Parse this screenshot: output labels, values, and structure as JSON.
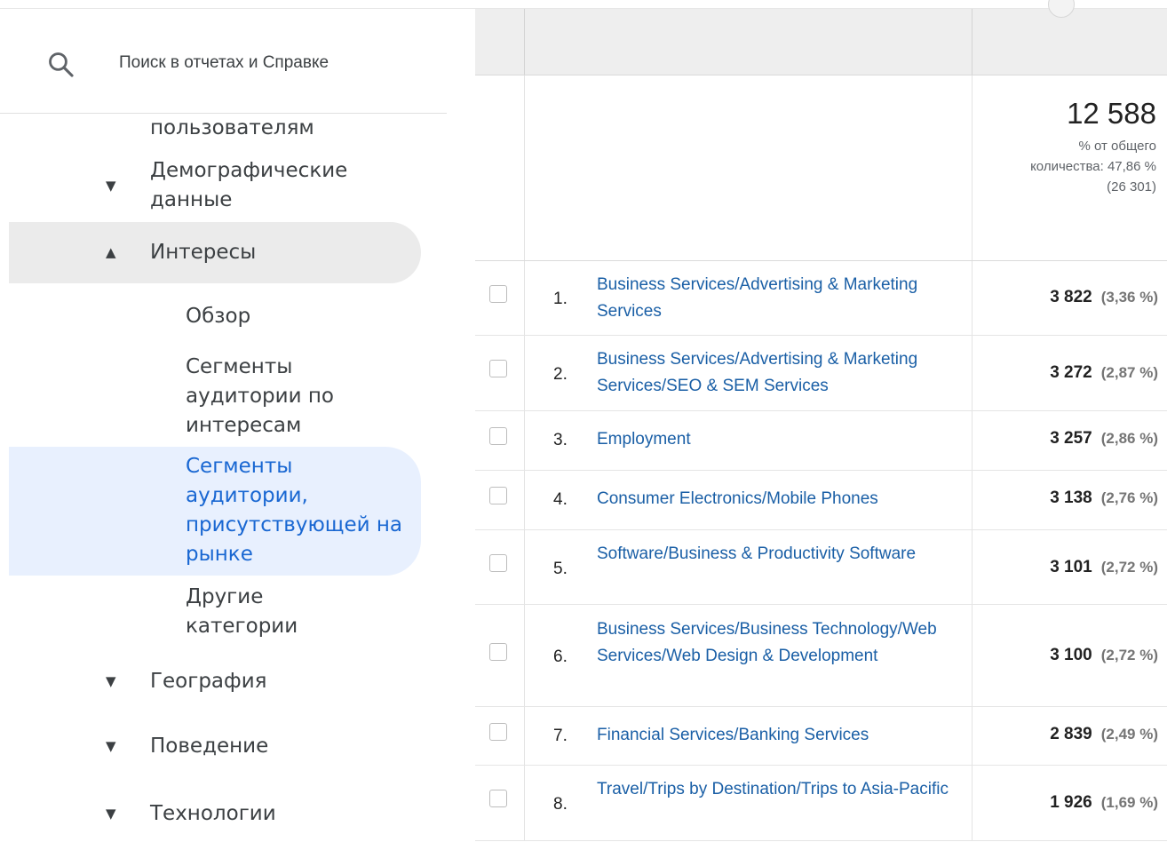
{
  "search": {
    "placeholder": "Поиск в отчетах и Справке"
  },
  "sidebar": {
    "items": [
      {
        "label": "пользователям"
      },
      {
        "label": "Демографические данные"
      },
      {
        "label": "Интересы"
      },
      {
        "label": "Обзор"
      },
      {
        "label": "Сегменты аудитории по интересам"
      },
      {
        "label": "Сегменты аудитории, присутствующей на рынке"
      },
      {
        "label": "Другие категории"
      },
      {
        "label": "География"
      },
      {
        "label": "Поведение"
      },
      {
        "label": "Технологии"
      }
    ]
  },
  "summary": {
    "total": "12 588",
    "note_line1": "% от общего",
    "note_line2": "количества: 47,86 %",
    "note_line3": "(26 301)"
  },
  "rows": [
    {
      "num": "1.",
      "name": "Business Services/Advertising & Marketing Services",
      "value": "3 822",
      "pct": "(3,36 %)"
    },
    {
      "num": "2.",
      "name": "Business Services/Advertising & Marketing Services/SEO & SEM Services",
      "value": "3 272",
      "pct": "(2,87 %)"
    },
    {
      "num": "3.",
      "name": "Employment",
      "value": "3 257",
      "pct": "(2,86 %)"
    },
    {
      "num": "4.",
      "name": "Consumer Electronics/Mobile Phones",
      "value": "3 138",
      "pct": "(2,76 %)"
    },
    {
      "num": "5.",
      "name": "Software/Business & Productivity Software",
      "value": "3 101",
      "pct": "(2,72 %)"
    },
    {
      "num": "6.",
      "name": "Business Services/Business Technology/Web Services/Web Design & Development",
      "value": "3 100",
      "pct": "(2,72 %)"
    },
    {
      "num": "7.",
      "name": "Financial Services/Banking Services",
      "value": "2 839",
      "pct": "(2,49 %)"
    },
    {
      "num": "8.",
      "name": "Travel/Trips by Destination/Trips to Asia-Pacific",
      "value": "1 926",
      "pct": "(1,69 %)"
    }
  ]
}
